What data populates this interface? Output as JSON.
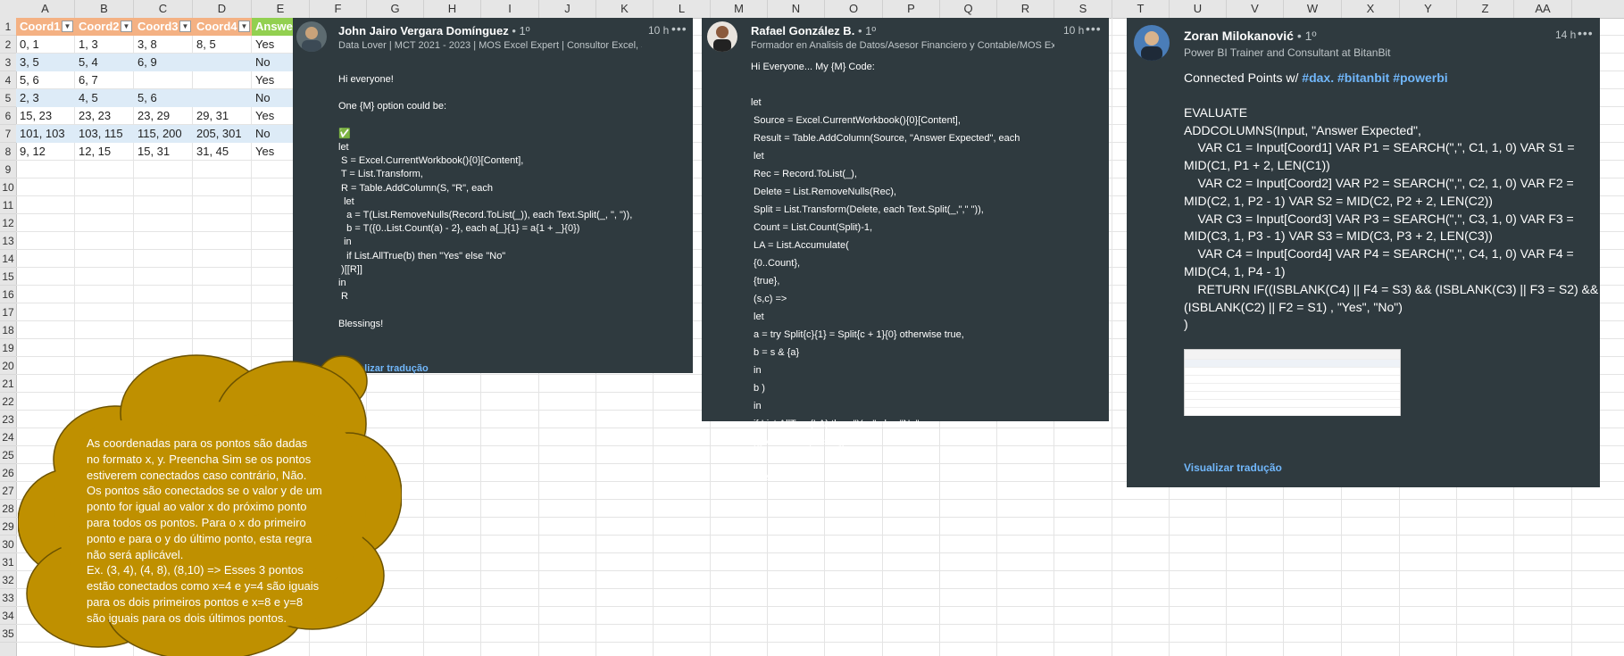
{
  "columns": [
    "A",
    "B",
    "C",
    "D",
    "E",
    "F",
    "G",
    "H",
    "I",
    "J",
    "K",
    "L",
    "M",
    "N",
    "O",
    "P",
    "Q",
    "R",
    "S",
    "T",
    "U",
    "V",
    "W",
    "X",
    "Y",
    "Z",
    "AA"
  ],
  "rows": [
    "1",
    "2",
    "3",
    "4",
    "5",
    "6",
    "7",
    "8",
    "9",
    "10",
    "11",
    "12",
    "13",
    "14",
    "15",
    "16",
    "17",
    "18",
    "19",
    "20",
    "21",
    "22",
    "23",
    "24",
    "25",
    "26",
    "27",
    "28",
    "29",
    "30",
    "31",
    "32",
    "33",
    "34",
    "35"
  ],
  "table": {
    "headers": [
      "Coord1",
      "Coord2",
      "Coord3",
      "Coord4",
      "Answer"
    ],
    "rows": [
      [
        "0, 1",
        "1, 3",
        "3, 8",
        "8, 5",
        "Yes"
      ],
      [
        "3, 5",
        "5, 4",
        "6, 9",
        "",
        "No"
      ],
      [
        "5, 6",
        "6, 7",
        "",
        "",
        "Yes"
      ],
      [
        "2, 3",
        "4, 5",
        "5, 6",
        "",
        "No"
      ],
      [
        "15, 23",
        "23, 23",
        "23, 29",
        "29, 31",
        "Yes"
      ],
      [
        "101, 103",
        "103, 115",
        "115, 200",
        "205, 301",
        "No"
      ],
      [
        "9, 12",
        "12, 15",
        "15, 31",
        "31, 45",
        "Yes"
      ]
    ]
  },
  "cards": [
    {
      "name": "John Jairo Vergara Domínguez",
      "degree": "• 1º",
      "subtitle": "Data Lover | MCT 2021 - 2023 | MOS Excel Expert | Consultor Excel, SQL, P...",
      "time": "10 h",
      "more": "•••",
      "body": "Hi everyone!\n\nOne {M} option could be:\n\n✅\nlet\n S = Excel.CurrentWorkbook(){0}[Content],\n T = List.Transform,\n R = Table.AddColumn(S, \"R\", each\n  let\n   a = T(List.RemoveNulls(Record.ToList(_)), each Text.Split(_, \", \")),\n   b = T({0..List.Count(a) - 2}, each a{_}{1} = a{1 + _}{0})\n  in\n   if List.AllTrue(b) then \"Yes\" else \"No\"\n )[[R]]\nin\n R\n\nBlessings!",
      "translate": "Visualizar tradução"
    },
    {
      "name": "Rafael González B.",
      "degree": "• 1º",
      "subtitle": "Formador en Analisis de Datos/Asesor Financiero y Contable/MOS Excel E...",
      "time": "10 h",
      "more": "•••",
      "body": "Hi Everyone... My {M} Code:\n\nlet\n Source = Excel.CurrentWorkbook(){0}[Content],\n Result = Table.AddColumn(Source, \"Answer Expected\", each\n let\n Rec = Record.ToList(_),\n Delete = List.RemoveNulls(Rec),\n Split = List.Transform(Delete, each Text.Split(_,\",\" \")),\n Count = List.Count(Split)-1,\n LA = List.Accumulate(\n {0..Count},\n {true},\n (s,c) =>\n let\n a = try Split{c}{1} = Split{c + 1}{0} otherwise true,\n b = s & {a}\n in\n b )\n in\n if List.AllTrue(LA) then \"Yes\" else \"No\"\n )[[Answer Expected]]\nin\n Result"
    },
    {
      "name": "Zoran Milokanović",
      "degree": "• 1º",
      "subtitle": "Power BI Trainer and Consultant at BitanBit",
      "time": "14 h",
      "more": "•••",
      "lead": "Connected Points w/ ",
      "tags": "#dax. #bitanbit #powerbi",
      "body": "\nEVALUATE\nADDCOLUMNS(Input, \"Answer Expected\",\n    VAR C1 = Input[Coord1] VAR P1 = SEARCH(\",\", C1, 1, 0) VAR S1 =\nMID(C1, P1 + 2, LEN(C1))\n    VAR C2 = Input[Coord2] VAR P2 = SEARCH(\",\", C2, 1, 0) VAR F2 =\nMID(C2, 1, P2 - 1) VAR S2 = MID(C2, P2 + 2, LEN(C2))\n    VAR C3 = Input[Coord3] VAR P3 = SEARCH(\",\", C3, 1, 0) VAR F3 =\nMID(C3, 1, P3 - 1) VAR S3 = MID(C3, P3 + 2, LEN(C3))\n    VAR C4 = Input[Coord4] VAR P4 = SEARCH(\",\", C4, 1, 0) VAR F4 =\nMID(C4, 1, P4 - 1)\n    RETURN IF((ISBLANK(C4) || F4 = S3) && (ISBLANK(C3) || F3 = S2) &&\n(ISBLANK(C2) || F2 = S1) , \"Yes\", \"No\")\n)",
      "translate": "Visualizar tradução"
    }
  ],
  "bubble": {
    "text": "As coordenadas para os pontos são dadas no formato x, y. Preencha Sim se os pontos estiverem conectados caso contrário, Não. Os pontos são conectados se o valor y de um ponto for igual ao valor x do próximo ponto para todos os pontos. Para o x do primeiro ponto e para o y do último ponto, esta regra não será aplicável.\nEx. (3, 4), (4, 8), (8,10) => Esses 3 pontos estão conectados como x=4 e y=4 são iguais para os dois primeiros pontos e x=8 e y=8 são iguais para os dois últimos pontos."
  },
  "colors": {
    "card_bg": "#2f3a3f",
    "header_fill": "#f4b183",
    "answer_fill": "#92d050",
    "band_fill": "#ddebf7",
    "bubble_fill": "#bf9000",
    "link": "#71b7fb"
  }
}
